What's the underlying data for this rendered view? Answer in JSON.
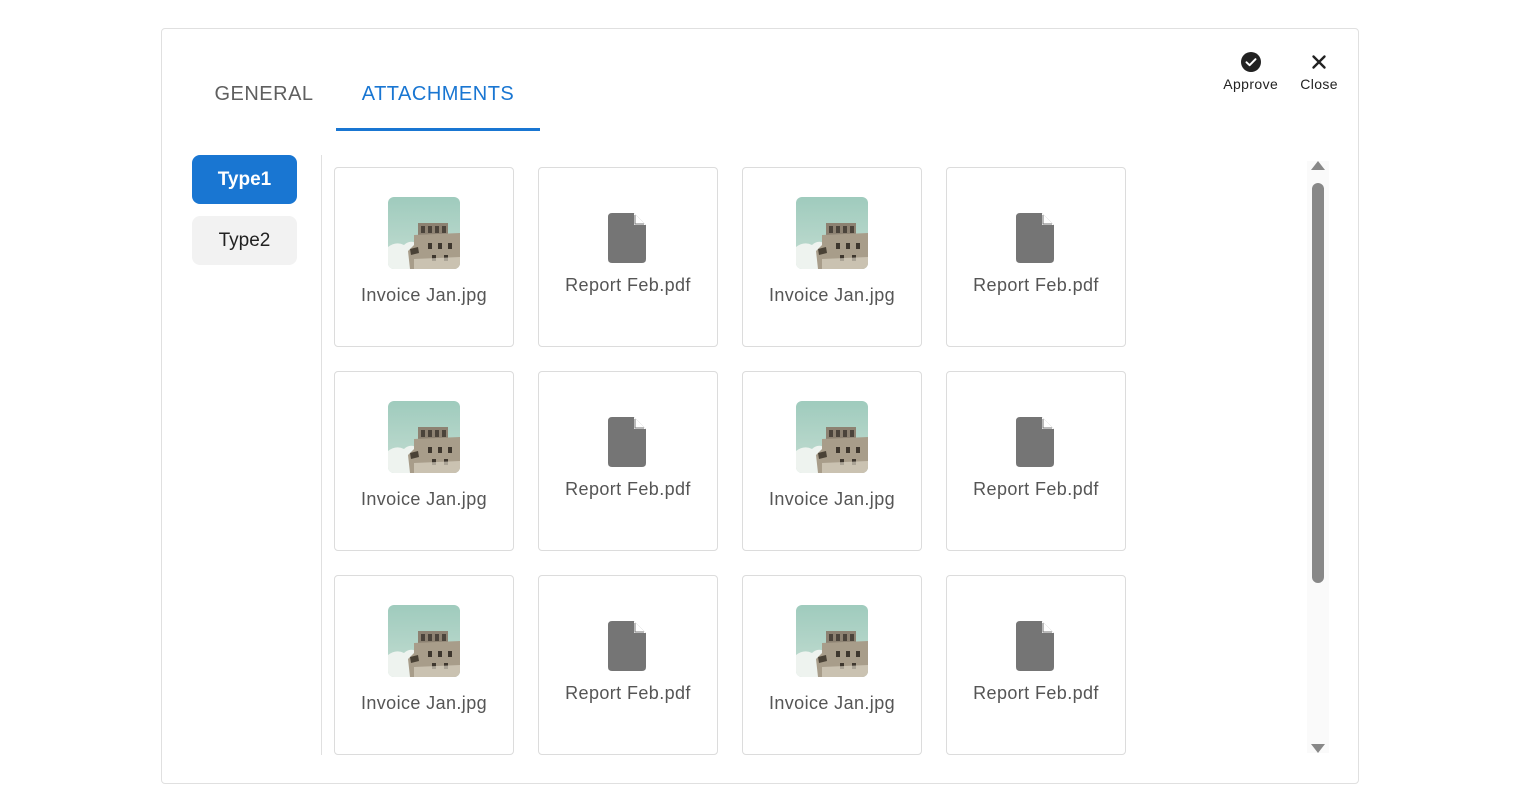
{
  "tabs": [
    {
      "label": "GENERAL",
      "active": false
    },
    {
      "label": "ATTACHMENTS",
      "active": true
    }
  ],
  "actions": {
    "approve_label": "Approve",
    "close_label": "Close"
  },
  "sidebar": {
    "items": [
      {
        "label": "Type1",
        "active": true
      },
      {
        "label": "Type2",
        "active": false
      }
    ]
  },
  "attachments": [
    {
      "name": "Invoice Jan.jpg",
      "kind": "image"
    },
    {
      "name": "Report Feb.pdf",
      "kind": "document"
    },
    {
      "name": "Invoice Jan.jpg",
      "kind": "image"
    },
    {
      "name": "Report Feb.pdf",
      "kind": "document"
    },
    {
      "name": "Invoice Jan.jpg",
      "kind": "image"
    },
    {
      "name": "Report Feb.pdf",
      "kind": "document"
    },
    {
      "name": "Invoice Jan.jpg",
      "kind": "image"
    },
    {
      "name": "Report Feb.pdf",
      "kind": "document"
    },
    {
      "name": "Invoice Jan.jpg",
      "kind": "image"
    },
    {
      "name": "Report Feb.pdf",
      "kind": "document"
    },
    {
      "name": "Invoice Jan.jpg",
      "kind": "image"
    },
    {
      "name": "Report Feb.pdf",
      "kind": "document"
    }
  ],
  "icons": {
    "approve": "check-circle-icon",
    "close": "close-icon",
    "image": "building-photo-thumbnail",
    "document": "document-icon"
  },
  "colors": {
    "accent": "#1976d2",
    "tab_inactive": "#5f5f5f",
    "doc_icon": "#757575",
    "scrollbar": "#888888"
  }
}
